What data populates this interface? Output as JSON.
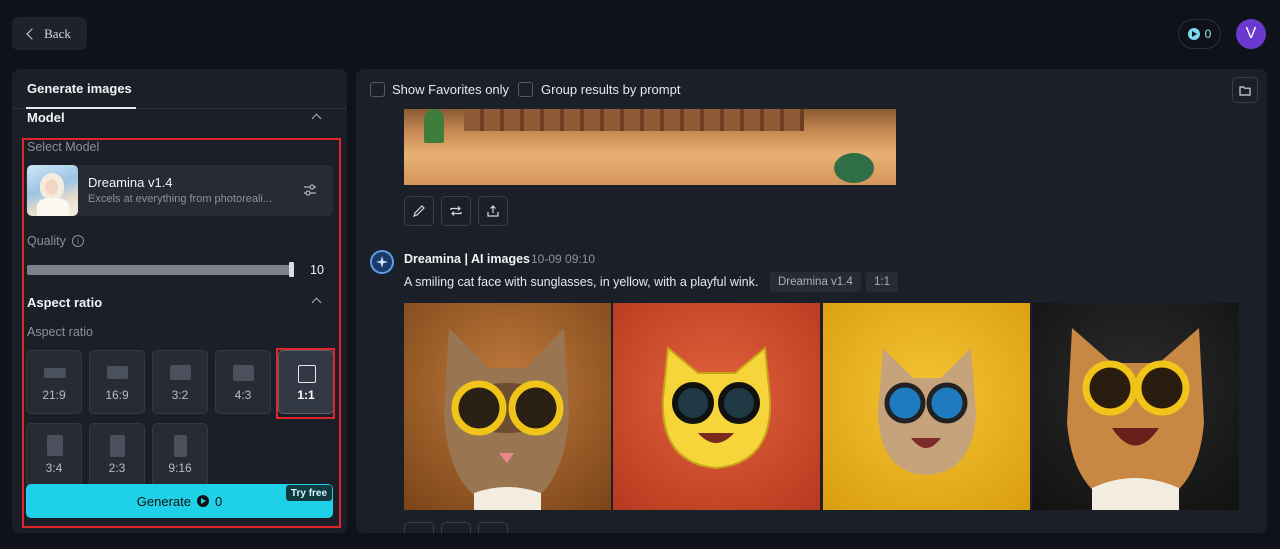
{
  "topbar": {
    "back_label": "Back",
    "credits": "0",
    "avatar_initial": "V"
  },
  "left": {
    "tab": "Generate images",
    "model_section": "Model",
    "select_model_label": "Select Model",
    "model_name": "Dreamina v1.4",
    "model_desc": "Excels at everything from photoreali...",
    "quality_label": "Quality",
    "quality_value": "10",
    "aspect_section": "Aspect ratio",
    "aspect_sub": "Aspect ratio",
    "ratios": [
      "21:9",
      "16:9",
      "3:2",
      "4:3",
      "1:1",
      "3:4",
      "2:3",
      "9:16"
    ],
    "selected_ratio": "1:1",
    "generate_label": "Generate",
    "generate_cost": "0",
    "try_free": "Try free"
  },
  "right": {
    "favorites_label": "Show Favorites only",
    "group_label": "Group results by prompt",
    "author": "Dreamina | AI images",
    "timestamp": "10-09  09:10",
    "prompt": "A smiling cat face with sunglasses, in yellow, with a playful wink.",
    "tags": [
      "Dreamina v1.4",
      "1:1"
    ]
  },
  "colors": {
    "accent": "#1fd1e8",
    "highlight": "#e0262a",
    "avatar": "#6a3ad0"
  }
}
